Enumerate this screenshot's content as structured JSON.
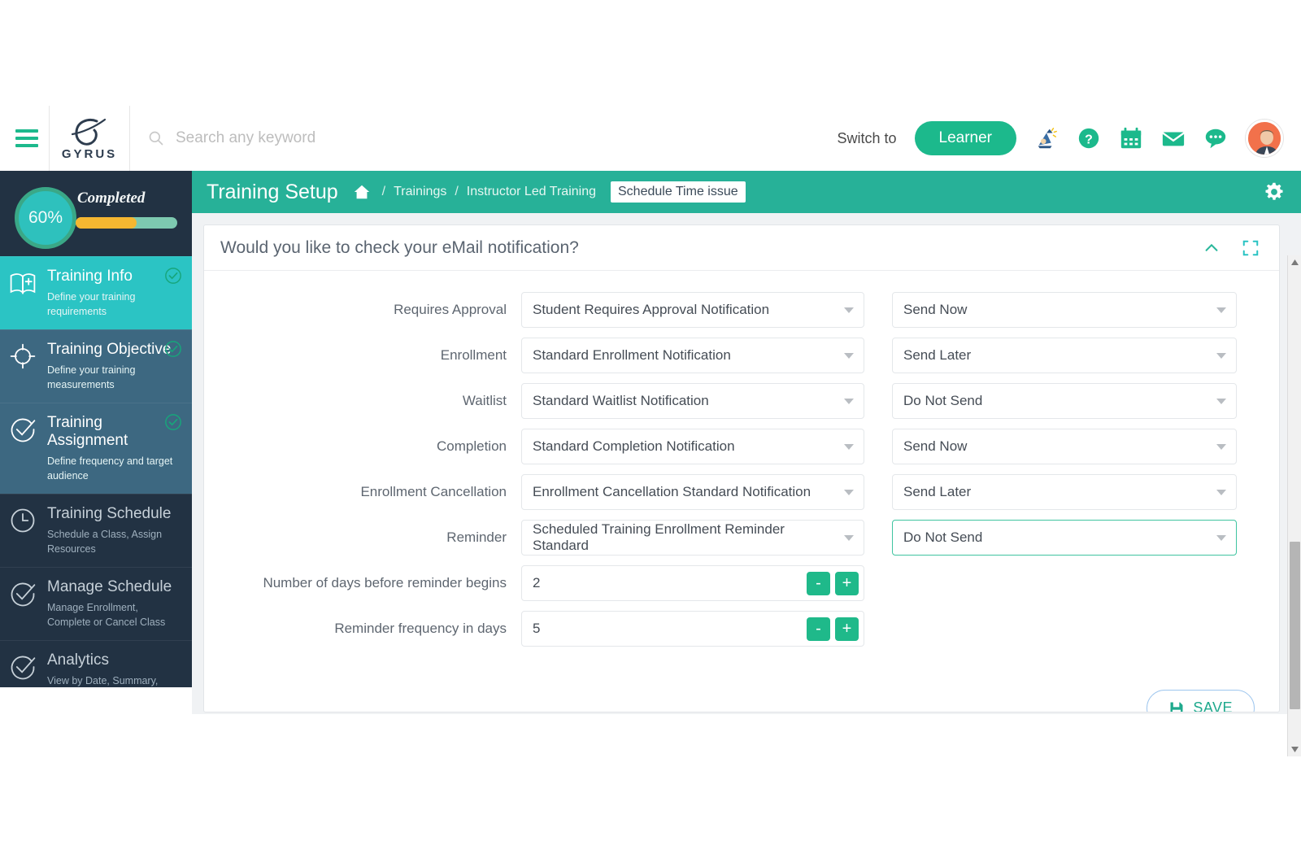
{
  "topnav": {
    "menu_icon": "hamburger-icon",
    "brand": {
      "name": "GYRUS",
      "logo_icon": "gyrus-logo-icon"
    },
    "search": {
      "placeholder": "Search any keyword",
      "value": "",
      "icon": "search-icon"
    },
    "switch_label": "Switch to",
    "learner_button": "Learner",
    "icons": [
      "wizard-icon",
      "help-icon",
      "calendar-icon",
      "mail-icon",
      "chat-icon",
      "avatar"
    ]
  },
  "sidebar": {
    "progress": {
      "percent": "60%",
      "percent_value": 60,
      "label": "Completed"
    },
    "items": [
      {
        "title": "Training Info",
        "subtitle": "Define your training requirements",
        "icon": "book-plus-icon",
        "state": "active",
        "completed": true
      },
      {
        "title": "Training Objective",
        "subtitle": "Define your training measurements",
        "icon": "target-icon",
        "state": "semi",
        "completed": true
      },
      {
        "title": "Training Assignment",
        "subtitle": "Define frequency and target audience",
        "icon": "check-circle-icon",
        "state": "semi",
        "completed": true
      },
      {
        "title": "Training Schedule",
        "subtitle": "Schedule a Class, Assign Resources",
        "icon": "clock-icon",
        "state": "dim",
        "completed": false
      },
      {
        "title": "Manage Schedule",
        "subtitle": "Manage Enrollment, Complete or Cancel Class",
        "icon": "check-circle-icon",
        "state": "dim",
        "completed": false
      },
      {
        "title": "Analytics",
        "subtitle": "View by Date, Summary, Graph",
        "icon": "check-circle-icon",
        "state": "dim",
        "completed": false
      }
    ]
  },
  "page": {
    "title": "Training Setup",
    "home_icon": "home-icon",
    "breadcrumb": [
      "Trainings",
      "Instructor Led Training"
    ],
    "separator": "/",
    "chip": "Schedule Time issue",
    "gear_icon": "gear-icon"
  },
  "panel": {
    "title": "Would you like to check your eMail notification?",
    "collapse_icon": "chevron-up-icon",
    "expand_icon": "fullscreen-icon",
    "rows": [
      {
        "label": "Requires Approval",
        "notification": "Student Requires Approval Notification",
        "timing": "Send Now",
        "focused": false
      },
      {
        "label": "Enrollment",
        "notification": "Standard Enrollment Notification",
        "timing": "Send Later",
        "focused": false
      },
      {
        "label": "Waitlist",
        "notification": "Standard Waitlist Notification",
        "timing": "Do Not Send",
        "focused": false
      },
      {
        "label": "Completion",
        "notification": "Standard Completion Notification",
        "timing": "Send Now",
        "focused": false
      },
      {
        "label": "Enrollment Cancellation",
        "notification": "Enrollment Cancellation Standard Notification",
        "timing": "Send Later",
        "focused": false
      },
      {
        "label": "Reminder",
        "notification": "Scheduled Training Enrollment Reminder Standard",
        "timing": "Do Not Send",
        "focused": true
      }
    ],
    "steppers": [
      {
        "label": "Number of days before reminder begins",
        "value": "2",
        "minus": "-",
        "plus": "+"
      },
      {
        "label": "Reminder frequency in days",
        "value": "5",
        "minus": "-",
        "plus": "+"
      }
    ],
    "save_label": "SAVE",
    "save_icon": "save-floppy-icon"
  },
  "colors": {
    "teal_header": "#27b198",
    "brand_green": "#1cb98c",
    "sidebar_dark": "#223243",
    "sidebar_active": "#2bc4c4",
    "sidebar_semi": "#3d6881",
    "progress_fill": "#f5b731",
    "avatar": "#f2714b"
  }
}
